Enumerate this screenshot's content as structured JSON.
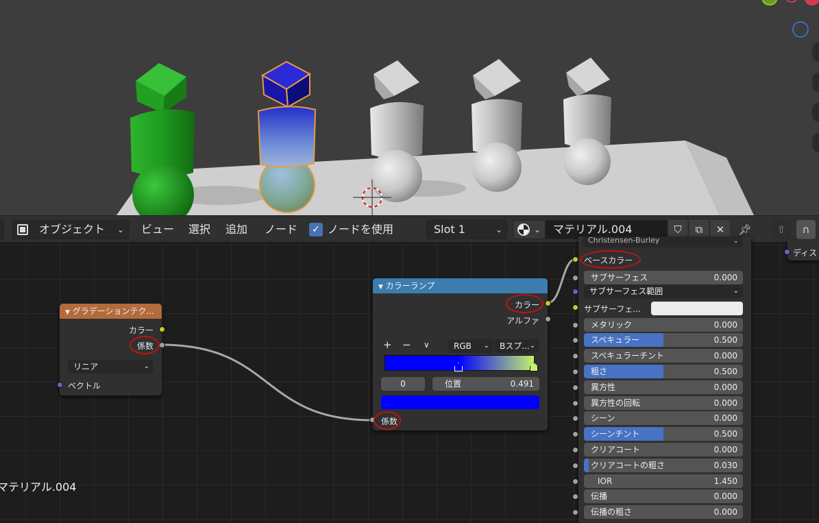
{
  "header": {
    "mode": "オブジェクト",
    "menu_view": "ビュー",
    "menu_select": "選択",
    "menu_add": "追加",
    "menu_node": "ノード",
    "use_nodes_label": "ノードを使用",
    "use_nodes_checked": true,
    "slot": "Slot 1",
    "material_name": "マテリアル.004"
  },
  "editor": {
    "material_label": "マテリアル.004"
  },
  "gradient_node": {
    "title": "グラデーションテク...",
    "out_color": "カラー",
    "out_fac": "係数",
    "type": "リニア",
    "in_vector": "ベクトル"
  },
  "colorramp_node": {
    "title": "カラーランプ",
    "out_color": "カラー",
    "out_alpha": "アルファ",
    "add_btn": "+",
    "remove_btn": "−",
    "menu_btn": "∨",
    "color_mode": "RGB",
    "interpolation": "Bスプ...",
    "stop_index": "0",
    "pos_label": "位置",
    "pos_value": "0.491",
    "in_fac": "係数",
    "gradient_stops": [
      {
        "pos": 0.0,
        "color": "#0000ff"
      },
      {
        "pos": 0.491,
        "color": "#0000ff"
      },
      {
        "pos": 1.0,
        "color": "#c6f06e"
      }
    ],
    "active_color": "#0000ff"
  },
  "bsdf_node": {
    "subsurface_method": "Christensen-Burley",
    "base_color": "ベースカラー",
    "subsurface_radius": "サブサーフェス範囲",
    "subsurface_color": "サブサーフェ...",
    "subsurface_color_value": "#ececec",
    "fields": [
      {
        "label": "サブサーフェス",
        "value": "0.000",
        "fill": 0
      },
      {
        "label": "メタリック",
        "value": "0.000",
        "fill": 0
      },
      {
        "label": "スペキュラー",
        "value": "0.500",
        "fill": 0.5
      },
      {
        "label": "スペキュラーチント",
        "value": "0.000",
        "fill": 0
      },
      {
        "label": "粗さ",
        "value": "0.500",
        "fill": 0.5
      },
      {
        "label": "異方性",
        "value": "0.000",
        "fill": 0
      },
      {
        "label": "異方性の回転",
        "value": "0.000",
        "fill": 0
      },
      {
        "label": "シーン",
        "value": "0.000",
        "fill": 0
      },
      {
        "label": "シーンチント",
        "value": "0.500",
        "fill": 0.5
      },
      {
        "label": "クリアコート",
        "value": "0.000",
        "fill": 0
      },
      {
        "label": "クリアコートの粗さ",
        "value": "0.030",
        "fill": 0.03
      },
      {
        "label": "IOR",
        "value": "1.450",
        "fill": 0
      },
      {
        "label": "伝播",
        "value": "0.000",
        "fill": 0
      },
      {
        "label": "伝播の粗さ",
        "value": "0.000",
        "fill": 0
      }
    ]
  },
  "output_node": {
    "in_disp": "ディス"
  },
  "colors": {
    "accent": "#4772b3",
    "socket_yellow": "#c7c729",
    "socket_gray": "#a1a1a1",
    "socket_blue": "#6363c7",
    "highlight_ring": "#c01414"
  }
}
